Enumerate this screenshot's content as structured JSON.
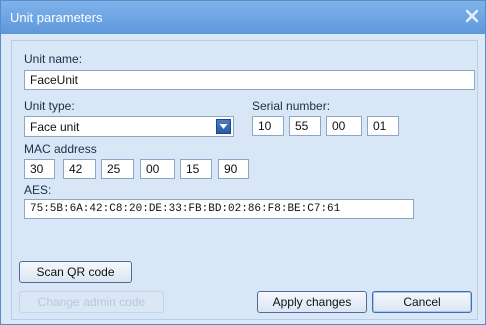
{
  "window": {
    "title": "Unit parameters",
    "close_icon": "close-icon"
  },
  "unit_name": {
    "label": "Unit name:",
    "value": "FaceUnit"
  },
  "unit_type": {
    "label": "Unit type:",
    "value": "Face unit",
    "arrow_icon": "dropdown-arrow-icon"
  },
  "serial": {
    "label": "Serial number:",
    "values": [
      "10",
      "55",
      "00",
      "01"
    ]
  },
  "mac": {
    "label": "MAC address",
    "values": [
      "30",
      "42",
      "25",
      "00",
      "15",
      "90"
    ]
  },
  "aes": {
    "label": "AES:",
    "value": "75:5B:6A:42:C8:20:DE:33:FB:BD:02:86:F8:BE:C7:61"
  },
  "buttons": {
    "scan_qr": "Scan QR code",
    "change_admin": "Change admin code",
    "apply": "Apply changes",
    "cancel": "Cancel"
  }
}
